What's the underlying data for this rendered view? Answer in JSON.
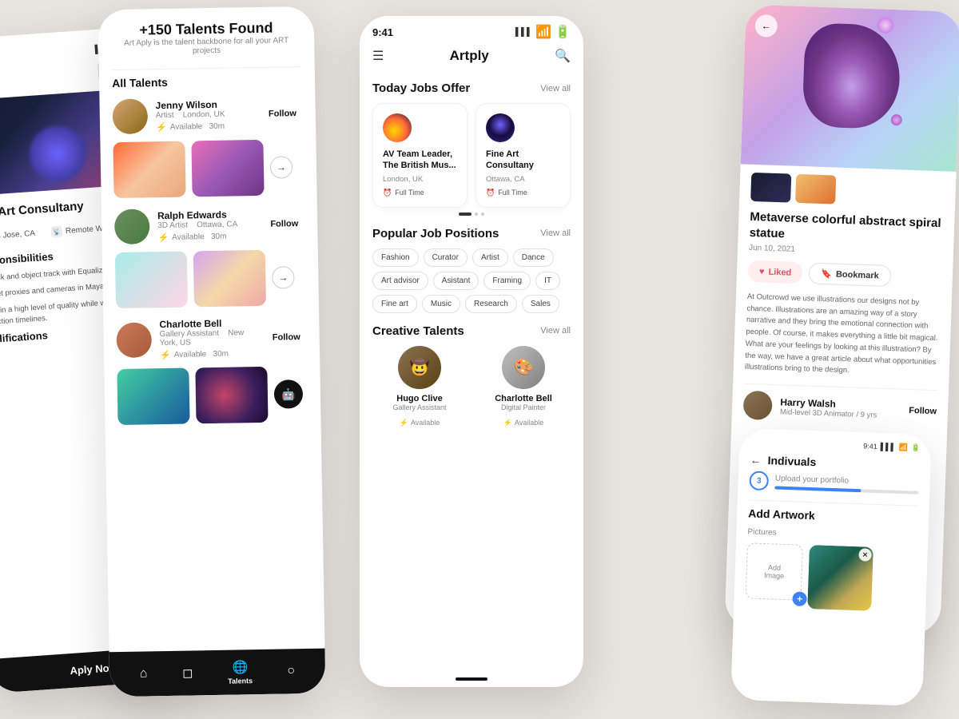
{
  "app": {
    "name": "Artply",
    "time": "9:41",
    "tagline": "Art Aply is the talent backbone for all your ART projects"
  },
  "phone1": {
    "job_title": "Fine Art Consultany",
    "location": "San Jose, CA",
    "work_type": "Remote Work",
    "section_responsibilities": "Responsibilities",
    "body_text1": "era track and object track with Equalizer or PFTrack.",
    "body_text2": "etup set proxies and cameras in Maya.",
    "body_text3": "Maintain a high level of quality while working within production timelines.",
    "section_qualifications": "Qualifications",
    "apply_btn": "Aply Now"
  },
  "phone2": {
    "header_title": "+150 Talents Found",
    "header_sub": "Art Aply is the talent backbone for all your ART projects",
    "section_label": "All Talents",
    "talents": [
      {
        "name": "Jenny Wilson",
        "role": "Artist",
        "location": "London, UK",
        "available": "Available",
        "time": "30m",
        "action": "Follow"
      },
      {
        "name": "Ralph Edwards",
        "role": "3D Artist",
        "location": "Ottawa, CA",
        "available": "Available",
        "time": "30m",
        "action": "Follow"
      },
      {
        "name": "Charlotte Bell",
        "role": "Gallery Assistant",
        "location": "New York, US",
        "available": "Available",
        "time": "30m",
        "action": "Follow"
      }
    ],
    "nav": [
      "home",
      "bag",
      "globe-talents",
      "profile"
    ],
    "active_nav": "Talents"
  },
  "phone3": {
    "status_time": "9:41",
    "app_title": "Artply",
    "today_jobs": "Today Jobs Offer",
    "view_all": "View all",
    "jobs": [
      {
        "title": "AV Team Leader, The British Mus...",
        "location": "London, UK",
        "type": "Full Time"
      },
      {
        "title": "Fine Art Consultany",
        "location": "Ottawa, CA",
        "type": "Full Time"
      }
    ],
    "popular_positions": "Popular Job Positions",
    "tags": [
      "Fashion",
      "Curator",
      "Artist",
      "Dance",
      "Art advisor",
      "Asistant",
      "Framing",
      "IT",
      "Fine art",
      "Music",
      "Research",
      "Sales"
    ],
    "creative_talents": "Creative Talents",
    "talents": [
      {
        "name": "Hugo Clive",
        "role": "Gallery Assistant",
        "available": "Available"
      },
      {
        "name": "Charlotte Bell",
        "role": "Digital Painter",
        "available": "Available"
      }
    ]
  },
  "phone4": {
    "back": "←",
    "artwork_title": "Metaverse colorful abstract spiral statue",
    "date": "Jun 10, 2021",
    "liked_btn": "Liked",
    "bookmark_btn": "Bookmark",
    "description": "At Outcrowd we use illustrations our designs not by chance. Illustrations are an amazing way of a story narrative and they bring the emotional connection with people. Of course, it makes everything a little bit magical. What are your feelings by looking at this illustration? By the way, we have a great article about what opportunities illustrations bring to the design.",
    "author_name": "Harry Walsh",
    "author_role": "Mid-level 3D Animator / 9 yrs",
    "follow": "Follow"
  },
  "phone5": {
    "status_time": "9:41",
    "screen_title": "Indivuals",
    "step": "3",
    "step_label": "Upload your portfolio",
    "progress": 60,
    "add_artwork": "Add Artwork",
    "pictures_label": "Pictures",
    "add_image_label": "Add Image"
  },
  "icons": {
    "search": "🔍",
    "bookmark": "🔖",
    "share": "↗",
    "home": "⌂",
    "bag": "◻",
    "globe": "◉",
    "user": "○",
    "heart": "♥",
    "lightning": "⚡",
    "clock": "⏰",
    "back_arrow": "←"
  }
}
